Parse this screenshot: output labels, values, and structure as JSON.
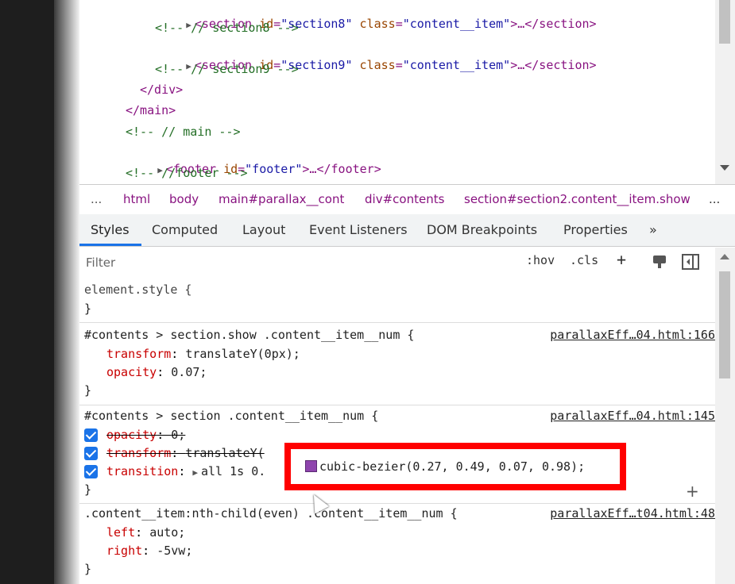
{
  "elements_tree": [
    {
      "indent": 4,
      "expander": true,
      "open": "<section",
      "attrs": [
        {
          "name": "id",
          "value": "\"section8\""
        },
        {
          "name": "class",
          "value": "\"content__item\""
        }
      ],
      "close": ">…</section>"
    },
    {
      "indent": 5,
      "comment": "<!-- // section8 -->"
    },
    {
      "indent": 4,
      "expander": true,
      "open": "<section",
      "attrs": [
        {
          "name": "id",
          "value": "\"section9\""
        },
        {
          "name": "class",
          "value": "\"content__item\""
        }
      ],
      "close": ">…</section>"
    },
    {
      "indent": 5,
      "comment": "<!-- // section9 -->"
    },
    {
      "indent": 3,
      "text": "</div>"
    },
    {
      "indent": 2,
      "text": "</main>"
    },
    {
      "indent": 2,
      "comment": "<!-- // main -->"
    },
    {
      "indent": 1,
      "expander": true,
      "open": "<footer",
      "attrs": [
        {
          "name": "id",
          "value": "\"footer\""
        }
      ],
      "close": ">…</footer>"
    },
    {
      "indent": 2,
      "comment": "<!-- //footer -->"
    }
  ],
  "breadcrumb": {
    "ellipsis": "...",
    "items": [
      {
        "tag": "html",
        "rest": ""
      },
      {
        "tag": "body",
        "rest": ""
      },
      {
        "tag": "main",
        "rest": "#parallax__cont"
      },
      {
        "tag": "div",
        "rest": "#contents"
      },
      {
        "tag": "section",
        "rest": "#section2.content__item.show"
      }
    ],
    "more": "..."
  },
  "tabs": [
    "Styles",
    "Computed",
    "Layout",
    "Event Listeners",
    "DOM Breakpoints",
    "Properties",
    "»"
  ],
  "filter": {
    "placeholder": "Filter",
    "hov": ":hov",
    "cls": ".cls",
    "plus": "+"
  },
  "rules": [
    {
      "selector": "element.style {",
      "close": "}",
      "source": "",
      "props": []
    },
    {
      "selector": "#contents > section.show .content__item__num {",
      "close": "}",
      "source": "parallaxEff…04.html:166",
      "props": [
        {
          "name": "transform",
          "value": "translateY(0px);"
        },
        {
          "name": "opacity",
          "value": "0.07;"
        }
      ]
    },
    {
      "selector": "#contents > section .content__item__num {",
      "close": "}",
      "source": "parallaxEff…04.html:145",
      "props": [
        {
          "name": "opacity",
          "value": "0;"
        },
        {
          "name": "transform",
          "value": "translateY("
        },
        {
          "name": "transition",
          "value": "all 1s 0."
        }
      ],
      "highlight": "cubic-bezier(0.27, 0.49, 0.07, 0.98);"
    },
    {
      "selector": ".content__item:nth-child(even) .content__item__num {",
      "close": "}",
      "source": "parallaxEff…t04.html:48",
      "props": [
        {
          "name": "left",
          "value": "auto;"
        },
        {
          "name": "right",
          "value": "-5vw;"
        }
      ]
    }
  ],
  "colors": {
    "accent": "#1a73e8",
    "highlight_box": "#ff0000",
    "tag": "#881280",
    "prop": "#c80000"
  }
}
